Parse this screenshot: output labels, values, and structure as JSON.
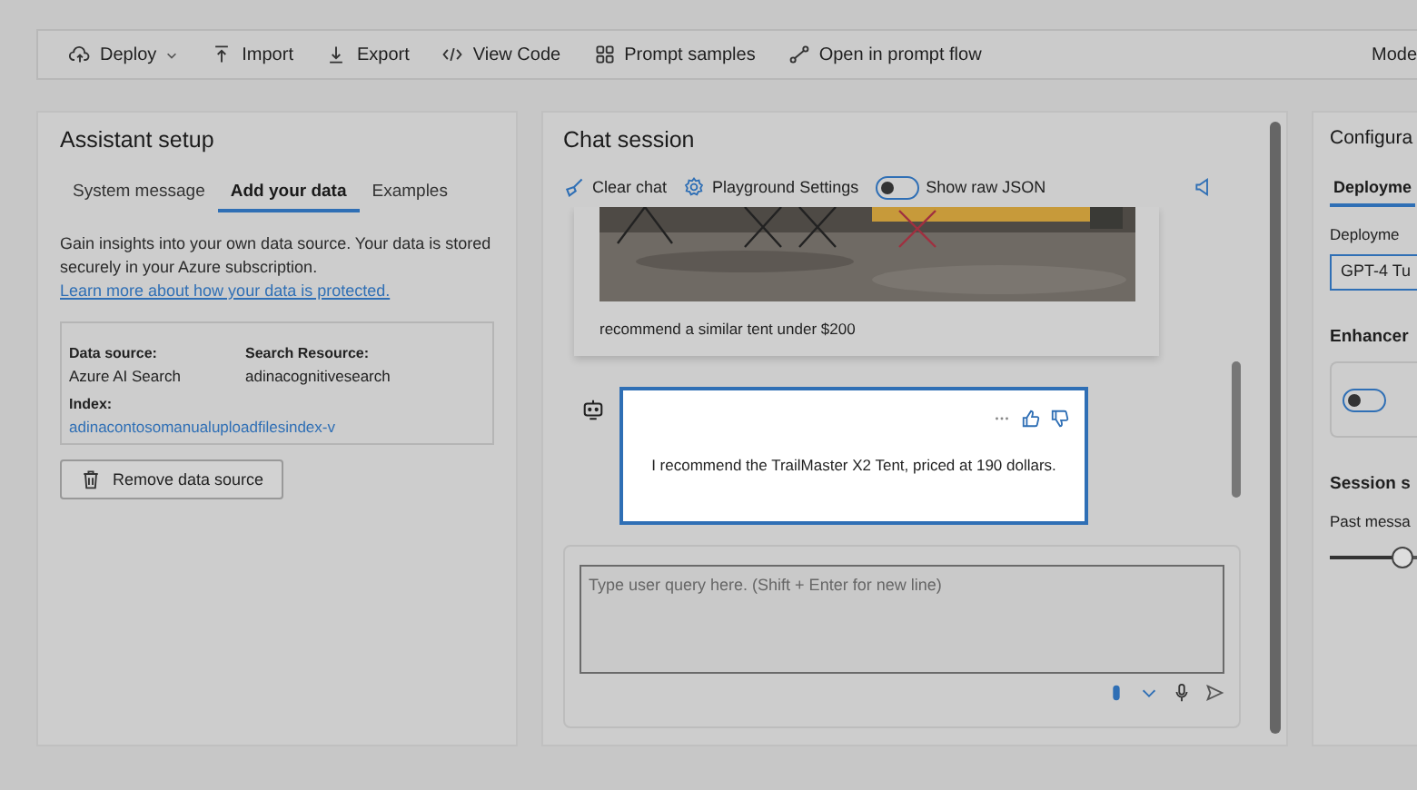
{
  "toolbar": {
    "items": [
      {
        "label": "Deploy",
        "has_menu": true
      },
      {
        "label": "Import",
        "has_menu": false
      },
      {
        "label": "Export",
        "has_menu": false
      },
      {
        "label": "View Code",
        "has_menu": false
      },
      {
        "label": "Prompt samples",
        "has_menu": false
      },
      {
        "label": "Open in prompt flow",
        "has_menu": false
      }
    ],
    "right_label": "Mode"
  },
  "assistant_setup": {
    "title": "Assistant setup",
    "tabs": [
      {
        "label": "System message",
        "selected": false
      },
      {
        "label": "Add your data",
        "selected": true
      },
      {
        "label": "Examples",
        "selected": false
      }
    ],
    "description": "Gain insights into your own data source. Your data is stored securely in your Azure subscription.",
    "link": "Learn more about how your data is protected.",
    "fields": [
      {
        "label": "Data source:",
        "value": "Azure AI Search",
        "kind": "text"
      },
      {
        "label": "Search Resource:",
        "value": "adinacognitivesearch",
        "kind": "text"
      },
      {
        "label": "Index:",
        "value": "adinacontosomanualuploadfilesindex-v",
        "kind": "link"
      }
    ],
    "remove_button": "Remove data source"
  },
  "chat_session": {
    "title": "Chat session",
    "actions": [
      {
        "label": "Clear chat"
      },
      {
        "label": "Playground Settings"
      }
    ],
    "raw_json_toggle": {
      "label": "Show raw JSON",
      "on": false
    },
    "messages": [
      {
        "kind": "picture",
        "text": "recommend a similar tent under $200"
      },
      {
        "kind": "reply",
        "text": "I recommend the TrailMaster X2 Tent, priced at 190 dollars.",
        "selected": true
      }
    ],
    "input": {
      "placeholder": "Type user query here. (Shift + Enter for new line)"
    }
  },
  "configuration": {
    "title": "Configura",
    "tabs": [
      {
        "label": "Deployme",
        "selected": true
      }
    ],
    "deployment_label": "Deployme",
    "deployment_value": "GPT-4 Tu",
    "enhancements_title": "Enhancer",
    "enhancement_toggle": {
      "on": false
    },
    "session_title": "Session s",
    "past_messages_label": "Past messa",
    "past_messages_slider": {
      "level": 0.35
    }
  }
}
